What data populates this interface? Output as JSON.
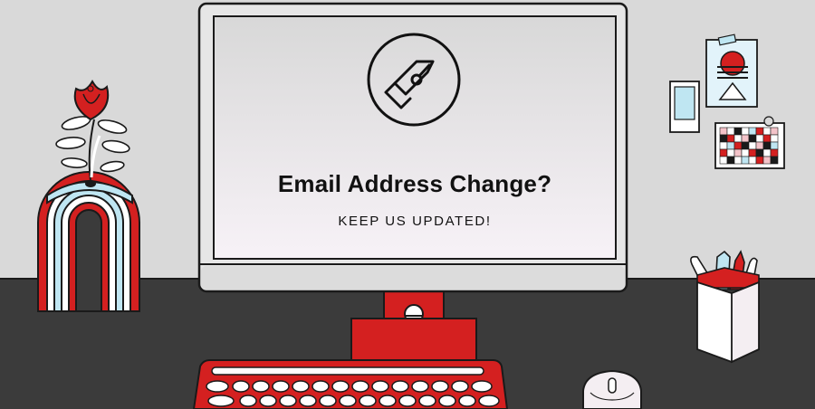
{
  "screen": {
    "headline": "Email Address Change?",
    "subline": "KEEP US UPDATED!"
  },
  "icons": {
    "pen": "pen-nib-icon"
  },
  "colors": {
    "wall": "#d9d9d9",
    "desk": "#3b3b3b",
    "accent_red": "#d42020",
    "outline": "#1a1a1a",
    "light_blue": "#bfe6f2"
  }
}
